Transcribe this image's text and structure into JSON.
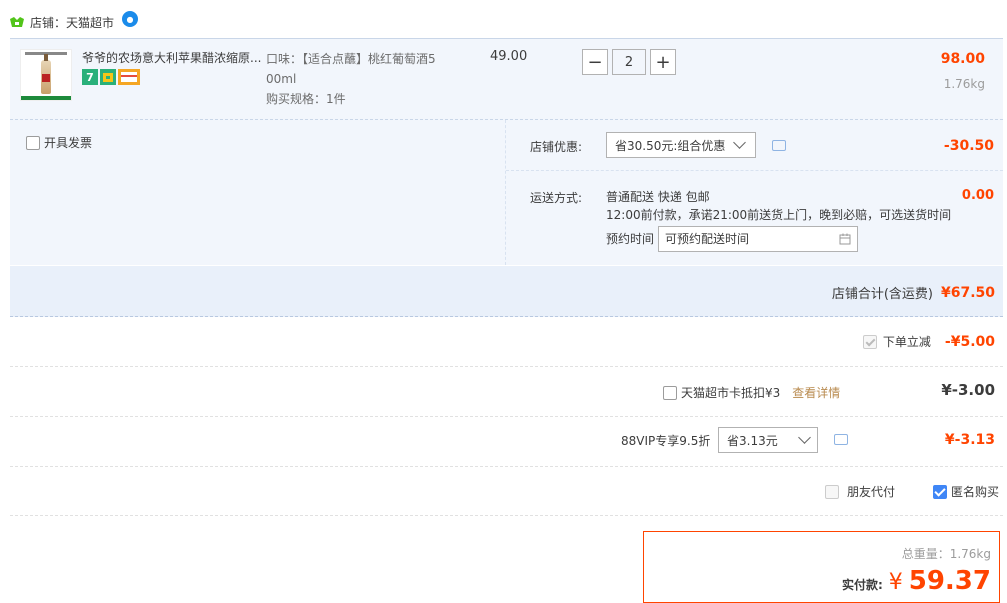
{
  "shop": {
    "label": "店铺：天猫超市",
    "icon": "shop-icon"
  },
  "item": {
    "title": "爷爷的农场意大利苹果醋浓缩原...",
    "badges": [
      "7",
      "chest",
      "card"
    ],
    "sku_line1": "口味：【适合点蘸】桃红葡萄酒5",
    "sku_line2": "00ml",
    "spec": "购买规格：1件",
    "unit_price": "49.00",
    "quantity": "2",
    "minus": "−",
    "plus": "+",
    "subtotal": "98.00",
    "weight": "1.76kg"
  },
  "invoice": {
    "label": "开具发票"
  },
  "shop_discount": {
    "label": "店铺优惠:",
    "selected": "省30.50元:组合优惠",
    "amount": "-30.50"
  },
  "shipping": {
    "label": "运送方式:",
    "line1": "普通配送 快递 包邮",
    "line2": "12:00前付款，承诺21:00前送货上门，晚到必赔，可选送货时间",
    "time_label": "预约时间",
    "time_placeholder": "可预约配送时间",
    "amount": "0.00"
  },
  "shop_total": {
    "label": "店铺合计(含运费)",
    "amount": "¥67.50"
  },
  "instant_discount": {
    "label": "下单立减",
    "amount": "-¥5.00"
  },
  "tmall_card": {
    "label": "天猫超市卡抵扣¥3",
    "link": "查看详情",
    "amount": "¥-3.00"
  },
  "vip": {
    "label": "88VIP专享9.5折",
    "selected": "省3.13元",
    "amount": "¥-3.13"
  },
  "friend_pay": {
    "label": "朋友代付"
  },
  "anonymous": {
    "label": "匿名购买"
  },
  "summary": {
    "weight_label": "总重量：1.76kg",
    "pay_label": "实付款:",
    "currency": "¥",
    "amount": "59.37"
  },
  "colors": {
    "accent": "#ff4400",
    "brand_blue": "#3f86f6",
    "row_bg": "#f2f6fc"
  }
}
